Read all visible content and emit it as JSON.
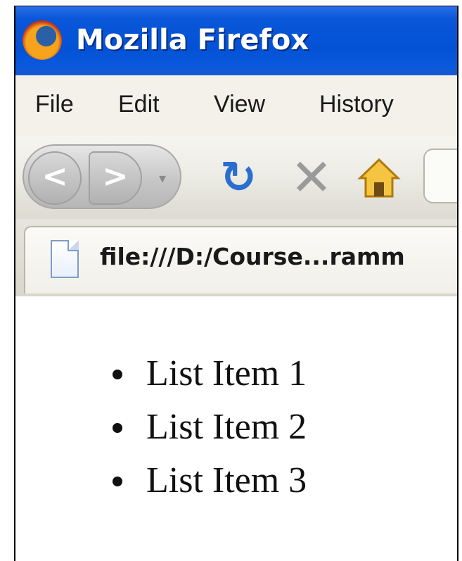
{
  "window": {
    "title": "Mozilla Firefox"
  },
  "menu": {
    "items": [
      "File",
      "Edit",
      "View",
      "History"
    ]
  },
  "tab": {
    "url": "file:///D:/Course...ramm"
  },
  "content": {
    "list": [
      "List Item 1",
      "List Item 2",
      "List Item 3"
    ]
  },
  "icons": {
    "logo": "firefox-logo-icon",
    "back": "back-arrow-icon",
    "forward": "forward-arrow-icon",
    "dropdown": "dropdown-arrow-icon",
    "reload": "reload-icon",
    "stop": "stop-icon",
    "home": "home-icon",
    "page": "page-icon"
  },
  "colors": {
    "titlebar": "#0352d6",
    "menubar": "#f3f1ea"
  }
}
